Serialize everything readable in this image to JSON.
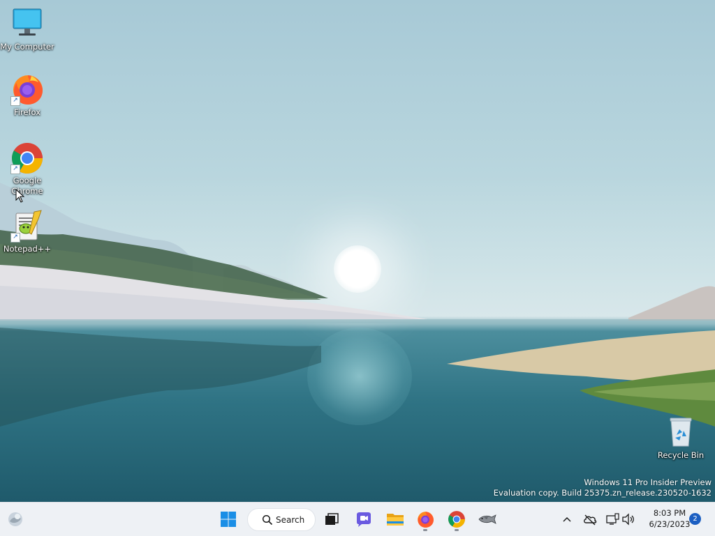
{
  "desktop": {
    "icons": [
      {
        "label": "My Computer"
      },
      {
        "label": "Firefox"
      },
      {
        "label": "Google Chrome"
      },
      {
        "label": "Notepad++"
      },
      {
        "label": "Recycle Bin"
      }
    ],
    "watermark": {
      "line1": "Windows 11 Pro Insider Preview",
      "line2": "Evaluation copy. Build 25375.zn_release.230520-1632"
    }
  },
  "taskbar": {
    "search_label": "Search",
    "pinned": [
      "widgets-icon",
      "start-icon",
      "task-view-icon",
      "chat-icon",
      "file-explorer-icon",
      "firefox-icon",
      "chrome-icon",
      "fish-app-icon"
    ],
    "clock": {
      "time": "8:03 PM",
      "date": "6/23/2023"
    },
    "notification_count": "2"
  },
  "colors": {
    "accent": "#1c5fc2",
    "taskbar_bg": "#eef1f5"
  }
}
